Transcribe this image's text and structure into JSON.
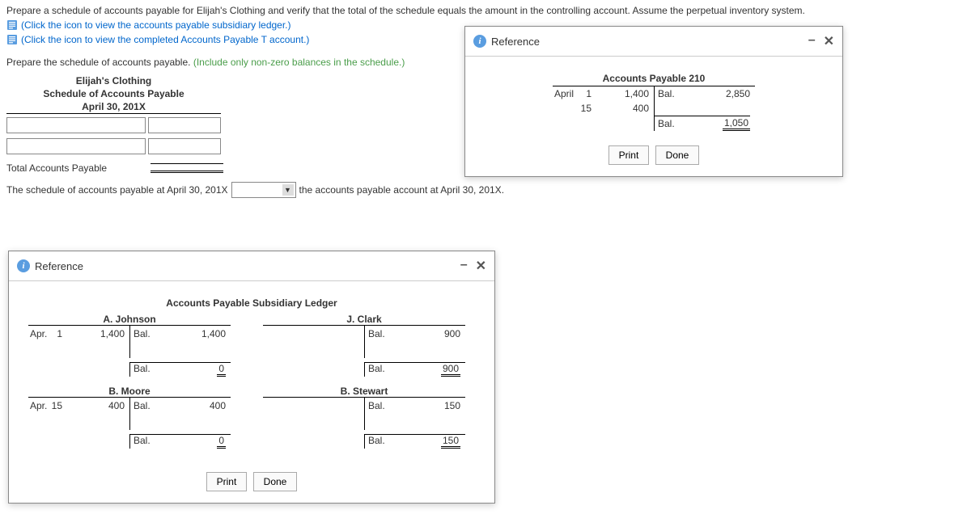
{
  "instructions": {
    "main": "Prepare a schedule of accounts payable for Elijah's Clothing and verify that the total of the schedule equals the amount in the controlling account. Assume the perpetual inventory system.",
    "link1": "(Click the icon to view the accounts payable subsidiary ledger.)",
    "link2": "(Click the icon to view the completed Accounts Payable T account.)",
    "prepare": "Prepare the schedule of accounts payable. ",
    "prepare_green": "(Include only non-zero balances in the schedule.)"
  },
  "schedule": {
    "company": "Elijah's Clothing",
    "title": "Schedule of Accounts Payable",
    "date": "April 30, 201X",
    "total_label": "Total Accounts Payable"
  },
  "sentence": {
    "part1": "The schedule of accounts payable at April 30, 201X",
    "part2": "the accounts payable account at April 30, 201X."
  },
  "panel_ap": {
    "title": "Reference",
    "t_title": "Accounts Payable 210",
    "left_rows": [
      {
        "mon": "April",
        "day": "1",
        "amt": "1,400"
      },
      {
        "mon": "",
        "day": "15",
        "amt": "400"
      }
    ],
    "right_rows": [
      {
        "lbl": "Bal.",
        "amt": "2,850"
      }
    ],
    "bal_label": "Bal.",
    "bal_value": "1,050",
    "print": "Print",
    "done": "Done"
  },
  "panel_sub": {
    "title": "Reference",
    "ledger_title": "Accounts Payable Subsidiary Ledger",
    "accounts": [
      {
        "name": "A. Johnson",
        "left": [
          {
            "mon": "Apr.",
            "day": "1",
            "amt": "1,400"
          }
        ],
        "right": [
          {
            "lbl": "Bal.",
            "amt": "1,400"
          }
        ],
        "bal_label": "Bal.",
        "bal_value": "0"
      },
      {
        "name": "J. Clark",
        "left": [],
        "right": [
          {
            "lbl": "Bal.",
            "amt": "900"
          }
        ],
        "bal_label": "Bal.",
        "bal_value": "900"
      },
      {
        "name": "B. Moore",
        "left": [
          {
            "mon": "Apr.",
            "day": "15",
            "amt": "400"
          }
        ],
        "right": [
          {
            "lbl": "Bal.",
            "amt": "400"
          }
        ],
        "bal_label": "Bal.",
        "bal_value": "0"
      },
      {
        "name": "B. Stewart",
        "left": [],
        "right": [
          {
            "lbl": "Bal.",
            "amt": "150"
          }
        ],
        "bal_label": "Bal.",
        "bal_value": "150"
      }
    ],
    "print": "Print",
    "done": "Done"
  }
}
